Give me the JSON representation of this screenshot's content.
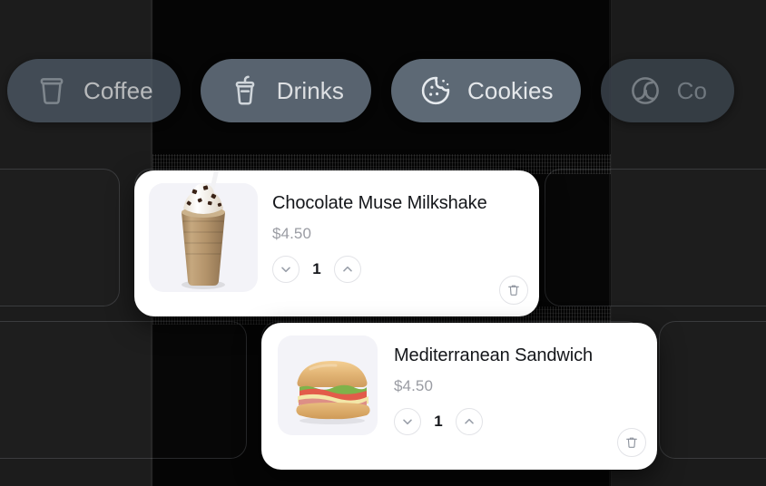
{
  "app": {
    "theme_background": "#0b0b0b",
    "card_background": "#ffffff",
    "chip_color": "#5b6773",
    "price_color": "#9a9ca3"
  },
  "categories": {
    "items": [
      {
        "label": "Coffee",
        "icon": "coffee-cup-icon",
        "selected": false
      },
      {
        "label": "Drinks",
        "icon": "soda-cup-icon",
        "selected": false
      },
      {
        "label": "Cookies",
        "icon": "cookie-icon",
        "selected": true
      },
      {
        "label": "Co",
        "icon": "coffee-bean-icon",
        "selected": false
      }
    ]
  },
  "cart": {
    "items": [
      {
        "name": "Chocolate Muse Milkshake",
        "price": "$4.50",
        "quantity": "1",
        "thumbnail": "milkshake-image",
        "decrease_label": "chevron-down-icon",
        "increase_label": "chevron-up-icon",
        "remove_label": "trash-icon"
      },
      {
        "name": "Mediterranean Sandwich",
        "price": "$4.50",
        "quantity": "1",
        "thumbnail": "sandwich-image",
        "decrease_label": "chevron-down-icon",
        "increase_label": "chevron-up-icon",
        "remove_label": "trash-icon"
      }
    ]
  }
}
